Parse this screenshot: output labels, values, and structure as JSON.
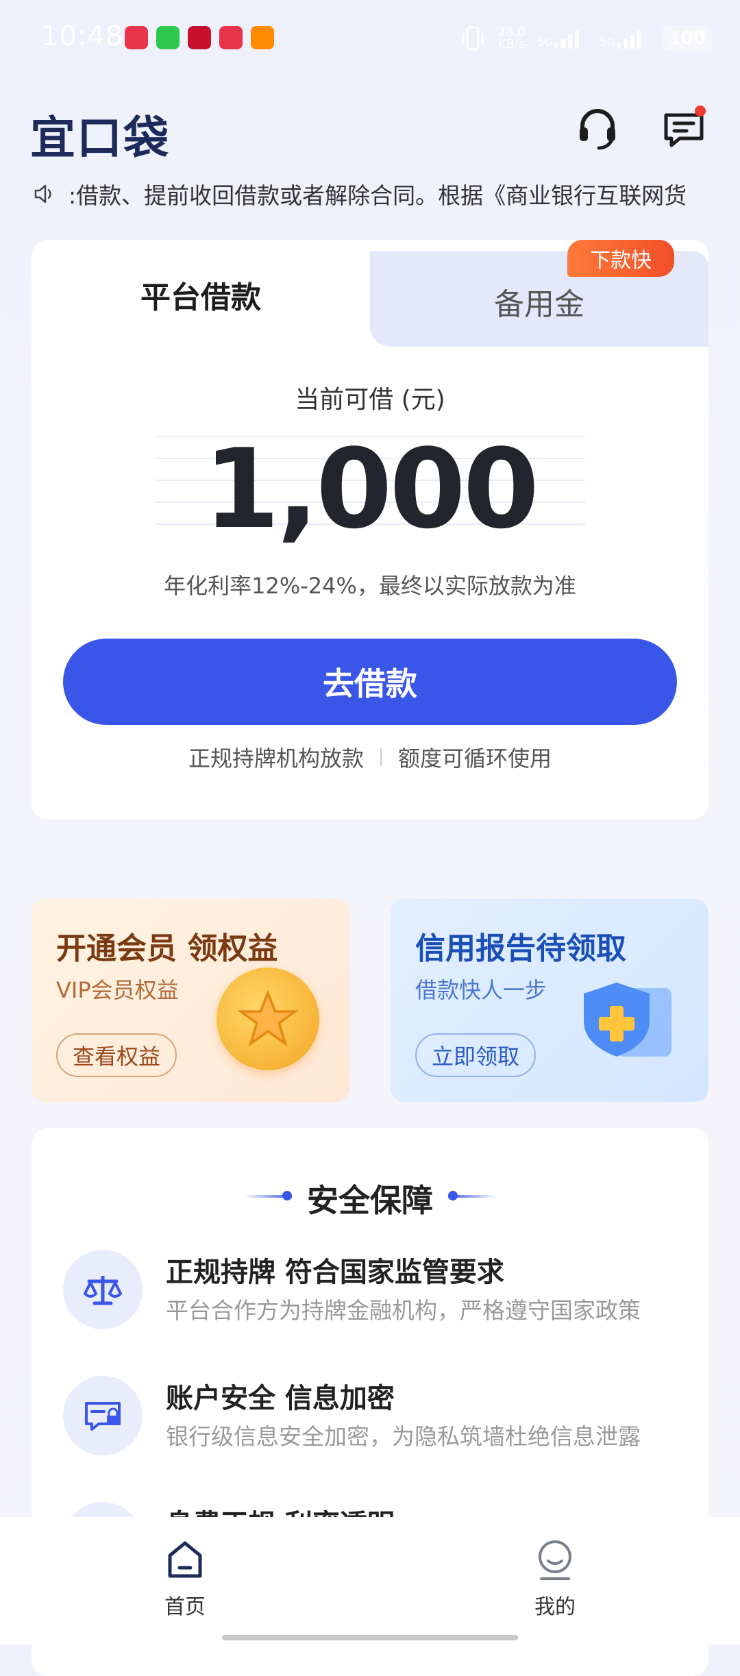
{
  "status_bar": {
    "time": "10:48",
    "speed_value": "28.0",
    "speed_unit": "KB/s",
    "network_1": "5G",
    "network_2": "5G",
    "battery": "100"
  },
  "header": {
    "logo_text": "宜口袋",
    "support_icon": "headset-icon",
    "message_icon": "message-icon",
    "message_has_dot": true
  },
  "notice": {
    "icon": "speaker-icon",
    "text": ":借款、提前收回借款或者解除合同。根据《商业银行互联网货"
  },
  "loan_card": {
    "tabs": [
      {
        "label": "平台借款",
        "active": true
      },
      {
        "label": "备用金",
        "active": false
      }
    ],
    "fast_badge": "下款快",
    "available_label": "当前可借 (元)",
    "amount": "1,000",
    "rate_text": "年化利率12%-24%，最终以实际放款为准",
    "borrow_button": "去借款",
    "feature_1": "正规持牌机构放款",
    "feature_2": "额度可循环使用"
  },
  "promos": {
    "vip": {
      "title": "开通会员 领权益",
      "subtitle": "VIP会员权益",
      "button": "查看权益"
    },
    "credit": {
      "title": "信用报告待领取",
      "subtitle": "借款快人一步",
      "button": "立即领取"
    }
  },
  "security": {
    "title": "安全保障",
    "items": [
      {
        "icon": "scale-icon",
        "title": "正规持牌 符合国家监管要求",
        "desc": "平台合作方为持牌金融机构，严格遵守国家政策"
      },
      {
        "icon": "secure-card-icon",
        "title": "账户安全 信息加密",
        "desc": "银行级信息安全加密，为隐私筑墙杜绝信息泄露"
      },
      {
        "icon": "fee-icon",
        "title": "息费正规 利率透明",
        "desc": ""
      }
    ]
  },
  "bottom_nav": {
    "items": [
      {
        "label": "首页",
        "icon": "home-icon",
        "active": true
      },
      {
        "label": "我的",
        "icon": "profile-icon",
        "active": false
      }
    ]
  },
  "colors": {
    "primary": "#3a56e8",
    "badge": "#f24f28",
    "logo": "#1c2b5a"
  }
}
